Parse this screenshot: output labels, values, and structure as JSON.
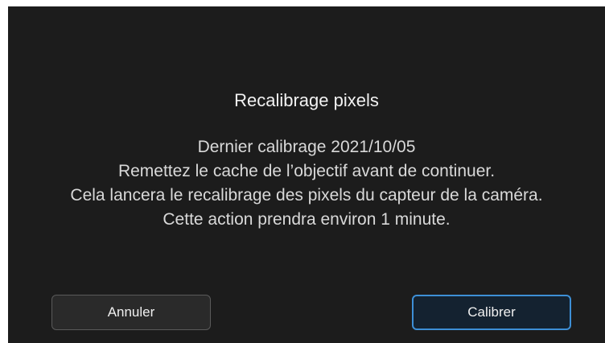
{
  "dialog": {
    "title": "Recalibrage pixels",
    "lines": [
      "Dernier calibrage 2021/10/05",
      "Remettez le cache de l’objectif avant de continuer.",
      "Cela lancera le recalibrage des pixels du capteur de la caméra.",
      "Cette action prendra environ 1 minute."
    ],
    "cancel_label": "Annuler",
    "confirm_label": "Calibrer"
  },
  "colors": {
    "background": "#1c1c1c",
    "accent": "#3d8fd6"
  }
}
